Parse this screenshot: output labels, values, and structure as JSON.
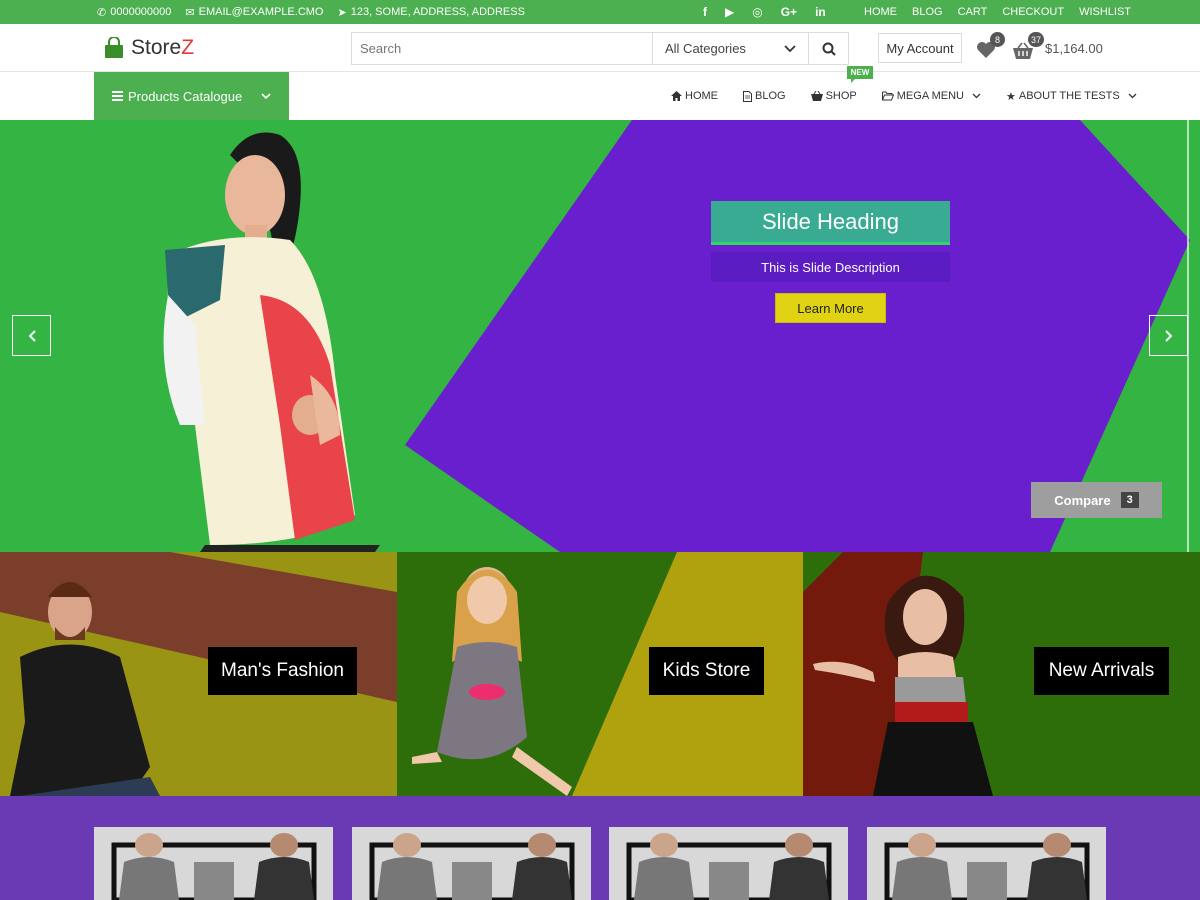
{
  "topbar": {
    "phone": "0000000000",
    "email": "EMAIL@EXAMPLE.CMO",
    "address": "123, SOME, ADDRESS, ADDRESS",
    "social": [
      "f",
      "▶",
      "◎",
      "G+",
      "in"
    ],
    "links": [
      "HOME",
      "BLOG",
      "CART",
      "CHECKOUT",
      "WISHLIST"
    ]
  },
  "header": {
    "logo_main": "Store",
    "logo_accent": "Z",
    "search_placeholder": "Search",
    "category_selected": "All Categories",
    "account_label": "My Account",
    "wishlist_count": "8",
    "cart_count": "37",
    "cart_total": "$1,164.00"
  },
  "nav": {
    "catalogue_label": "Products Catalogue",
    "items": [
      {
        "label": "HOME"
      },
      {
        "label": "BLOG"
      },
      {
        "label": "SHOP",
        "badge": "NEW"
      },
      {
        "label": "MEGA MENU"
      },
      {
        "label": "ABOUT THE TESTS"
      }
    ]
  },
  "slider": {
    "heading": "Slide Heading",
    "description": "This is Slide Description",
    "button": "Learn More",
    "compare_label": "Compare",
    "compare_count": "3"
  },
  "banners": [
    {
      "label": "Man's Fashion"
    },
    {
      "label": "Kids Store"
    },
    {
      "label": "New Arrivals"
    }
  ],
  "colors": {
    "brand_green": "#4caf50",
    "slide_green": "#33b443",
    "slide_purple": "#6a1fcf",
    "bottom_purple": "#6a3ab5",
    "accent_yellow": "#e0d314"
  }
}
